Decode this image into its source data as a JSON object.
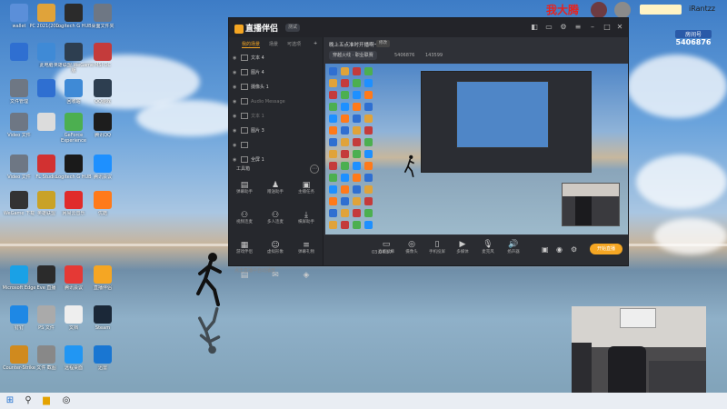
{
  "desktop": {
    "icons": [
      {
        "label": "wallet",
        "color": "#5b8fd9"
      },
      {
        "label": "PC 2021(200...",
        "color": "#e0a33a"
      },
      {
        "label": "Logitech G HUB",
        "color": "#2b2b2b"
      },
      {
        "label": "桌面文件夹",
        "color": "#6e7784"
      },
      {
        "label": "",
        "color": "#2f6fd1"
      },
      {
        "label": "此电脑",
        "color": "#3f8ad6"
      },
      {
        "label": "英雄联盟 WeGame版",
        "color": "#2d3e50"
      },
      {
        "label": "MSI OC",
        "color": "#c43b3b"
      },
      {
        "label": "文件管理",
        "color": "#6e7784"
      },
      {
        "label": "",
        "color": "#2f6fd1"
      },
      {
        "label": "回收站",
        "color": "#3f8ad6"
      },
      {
        "label": "QQ游戏",
        "color": "#2d3e50"
      },
      {
        "label": "Video 文件",
        "color": "#6e7784"
      },
      {
        "label": "",
        "color": "#dcdcdc"
      },
      {
        "label": "GeForce Experience",
        "color": "#4caf50"
      },
      {
        "label": "腾讯QQ",
        "color": "#1d1d1d"
      },
      {
        "label": "Video 文件",
        "color": "#6e7784"
      },
      {
        "label": "FL Studio",
        "color": "#d23131"
      },
      {
        "label": "Logitech G HUB",
        "color": "#1a1a1a"
      },
      {
        "label": "腾讯会议",
        "color": "#1e90ff"
      },
      {
        "label": "WeGame 下载",
        "color": "#333"
      },
      {
        "label": "英雄联盟",
        "color": "#c9a227"
      },
      {
        "label": "网易云音乐",
        "color": "#e02b2b"
      },
      {
        "label": "优酷",
        "color": "#ff7a1a"
      },
      {
        "label": "Microsoft Edge",
        "color": "#1aa1e6"
      },
      {
        "label": "Eve 直播",
        "color": "#2b2b2b"
      },
      {
        "label": "腾讯会议",
        "color": "#e53935"
      },
      {
        "label": "直播伴侣",
        "color": "#f5a623"
      },
      {
        "label": "钉钉",
        "color": "#1e88e5"
      },
      {
        "label": "PS 文件",
        "color": "#aaa"
      },
      {
        "label": "文档",
        "color": "#eee"
      },
      {
        "label": "Steam",
        "color": "#1b2838"
      },
      {
        "label": "Counter-Strike",
        "color": "#d08a1e"
      },
      {
        "label": "文件 截图",
        "color": "#888"
      },
      {
        "label": "远程桌面",
        "color": "#2196f3"
      },
      {
        "label": "迅雷",
        "color": "#1976d2"
      },
      {
        "label": "Chrome",
        "color": "#4caf50"
      },
      {
        "label": "PS 文件",
        "color": "#c62828"
      },
      {
        "label": "新建",
        "color": "#eee"
      }
    ]
  },
  "app": {
    "logo": "直播伴侣",
    "version": "测试",
    "sidebar_tabs": [
      "我的场景",
      "场景",
      "可选项"
    ],
    "layers": [
      {
        "label": "文本 4",
        "dim": false
      },
      {
        "label": "图片 4",
        "dim": false
      },
      {
        "label": "摄像头 1",
        "dim": false
      },
      {
        "label": "Audio Message",
        "dim": true
      },
      {
        "label": "文本 1",
        "dim": true
      },
      {
        "label": "图片 3",
        "dim": false
      },
      {
        "label": "",
        "dim": true
      },
      {
        "label": "全屏 1",
        "dim": false
      }
    ],
    "tools_title": "工具箱",
    "tools": [
      "弹幕助手",
      "赠送助手",
      "主播任务",
      "视频连麦",
      "多人连麦",
      "横屏助手",
      "游戏伴侣",
      "虚拟形象",
      "弹幕礼物",
      "",
      "",
      ""
    ],
    "hint": "点击直播中自动播放",
    "main": {
      "title": "晚上五点准时开播啊～",
      "tag": "修改",
      "tabs": [
        "穿越火线 · 职业联赛"
      ],
      "room_id": "5406876",
      "viewers": "143599"
    },
    "controls": [
      "直播屏幕",
      "摄像头",
      "手机投屏",
      "多媒体",
      "麦克风",
      "扬声器"
    ],
    "live_button": "开始直播",
    "time": "03:04:57"
  },
  "overlay": {
    "streamer_name": "我大腾",
    "user_name": "iRantzz",
    "room_label": "房间号",
    "room_number": "5406876"
  },
  "taskbar": {
    "items": [
      "windows-logo",
      "search",
      "file-explorer",
      "wegame",
      "steam"
    ]
  }
}
